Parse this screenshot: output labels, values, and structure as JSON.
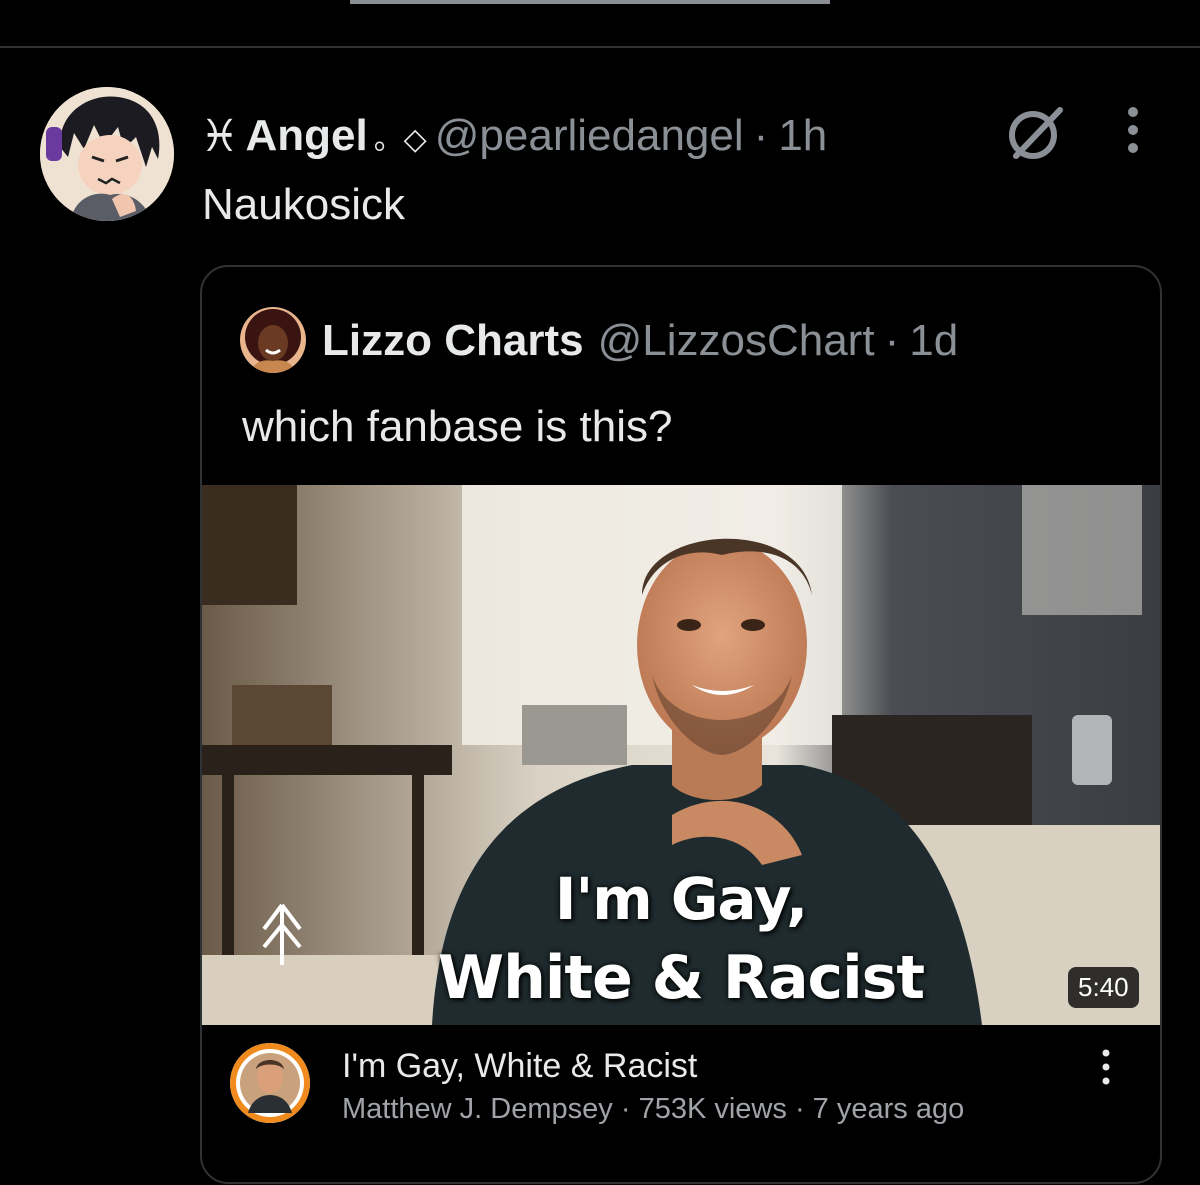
{
  "tweet": {
    "glyph": "♓︎",
    "display_name": "Angel",
    "name_deco": "。◇",
    "handle": "@pearliedangel",
    "separator": "·",
    "time": "1h",
    "text": "Naukosick"
  },
  "quoted_tweet": {
    "display_name": "Lizzo Charts",
    "handle": "@LizzosChart",
    "separator": "·",
    "time": "1d",
    "text": "which fanbase is this?"
  },
  "video": {
    "caption_line1": "I'm Gay,",
    "caption_line2": "White & Racist",
    "duration": "5:40",
    "title": "I'm Gay, White & Racist",
    "channel": "Matthew J. Dempsey",
    "views": "753K views",
    "age": "7 years ago",
    "separator": "·"
  },
  "colors": {
    "background": "#000000",
    "text_primary": "#e7e9ea",
    "text_secondary": "#8b9096",
    "border": "#2f3336"
  },
  "icons": [
    "grok-icon",
    "more-options-icon",
    "video-more-icon"
  ]
}
